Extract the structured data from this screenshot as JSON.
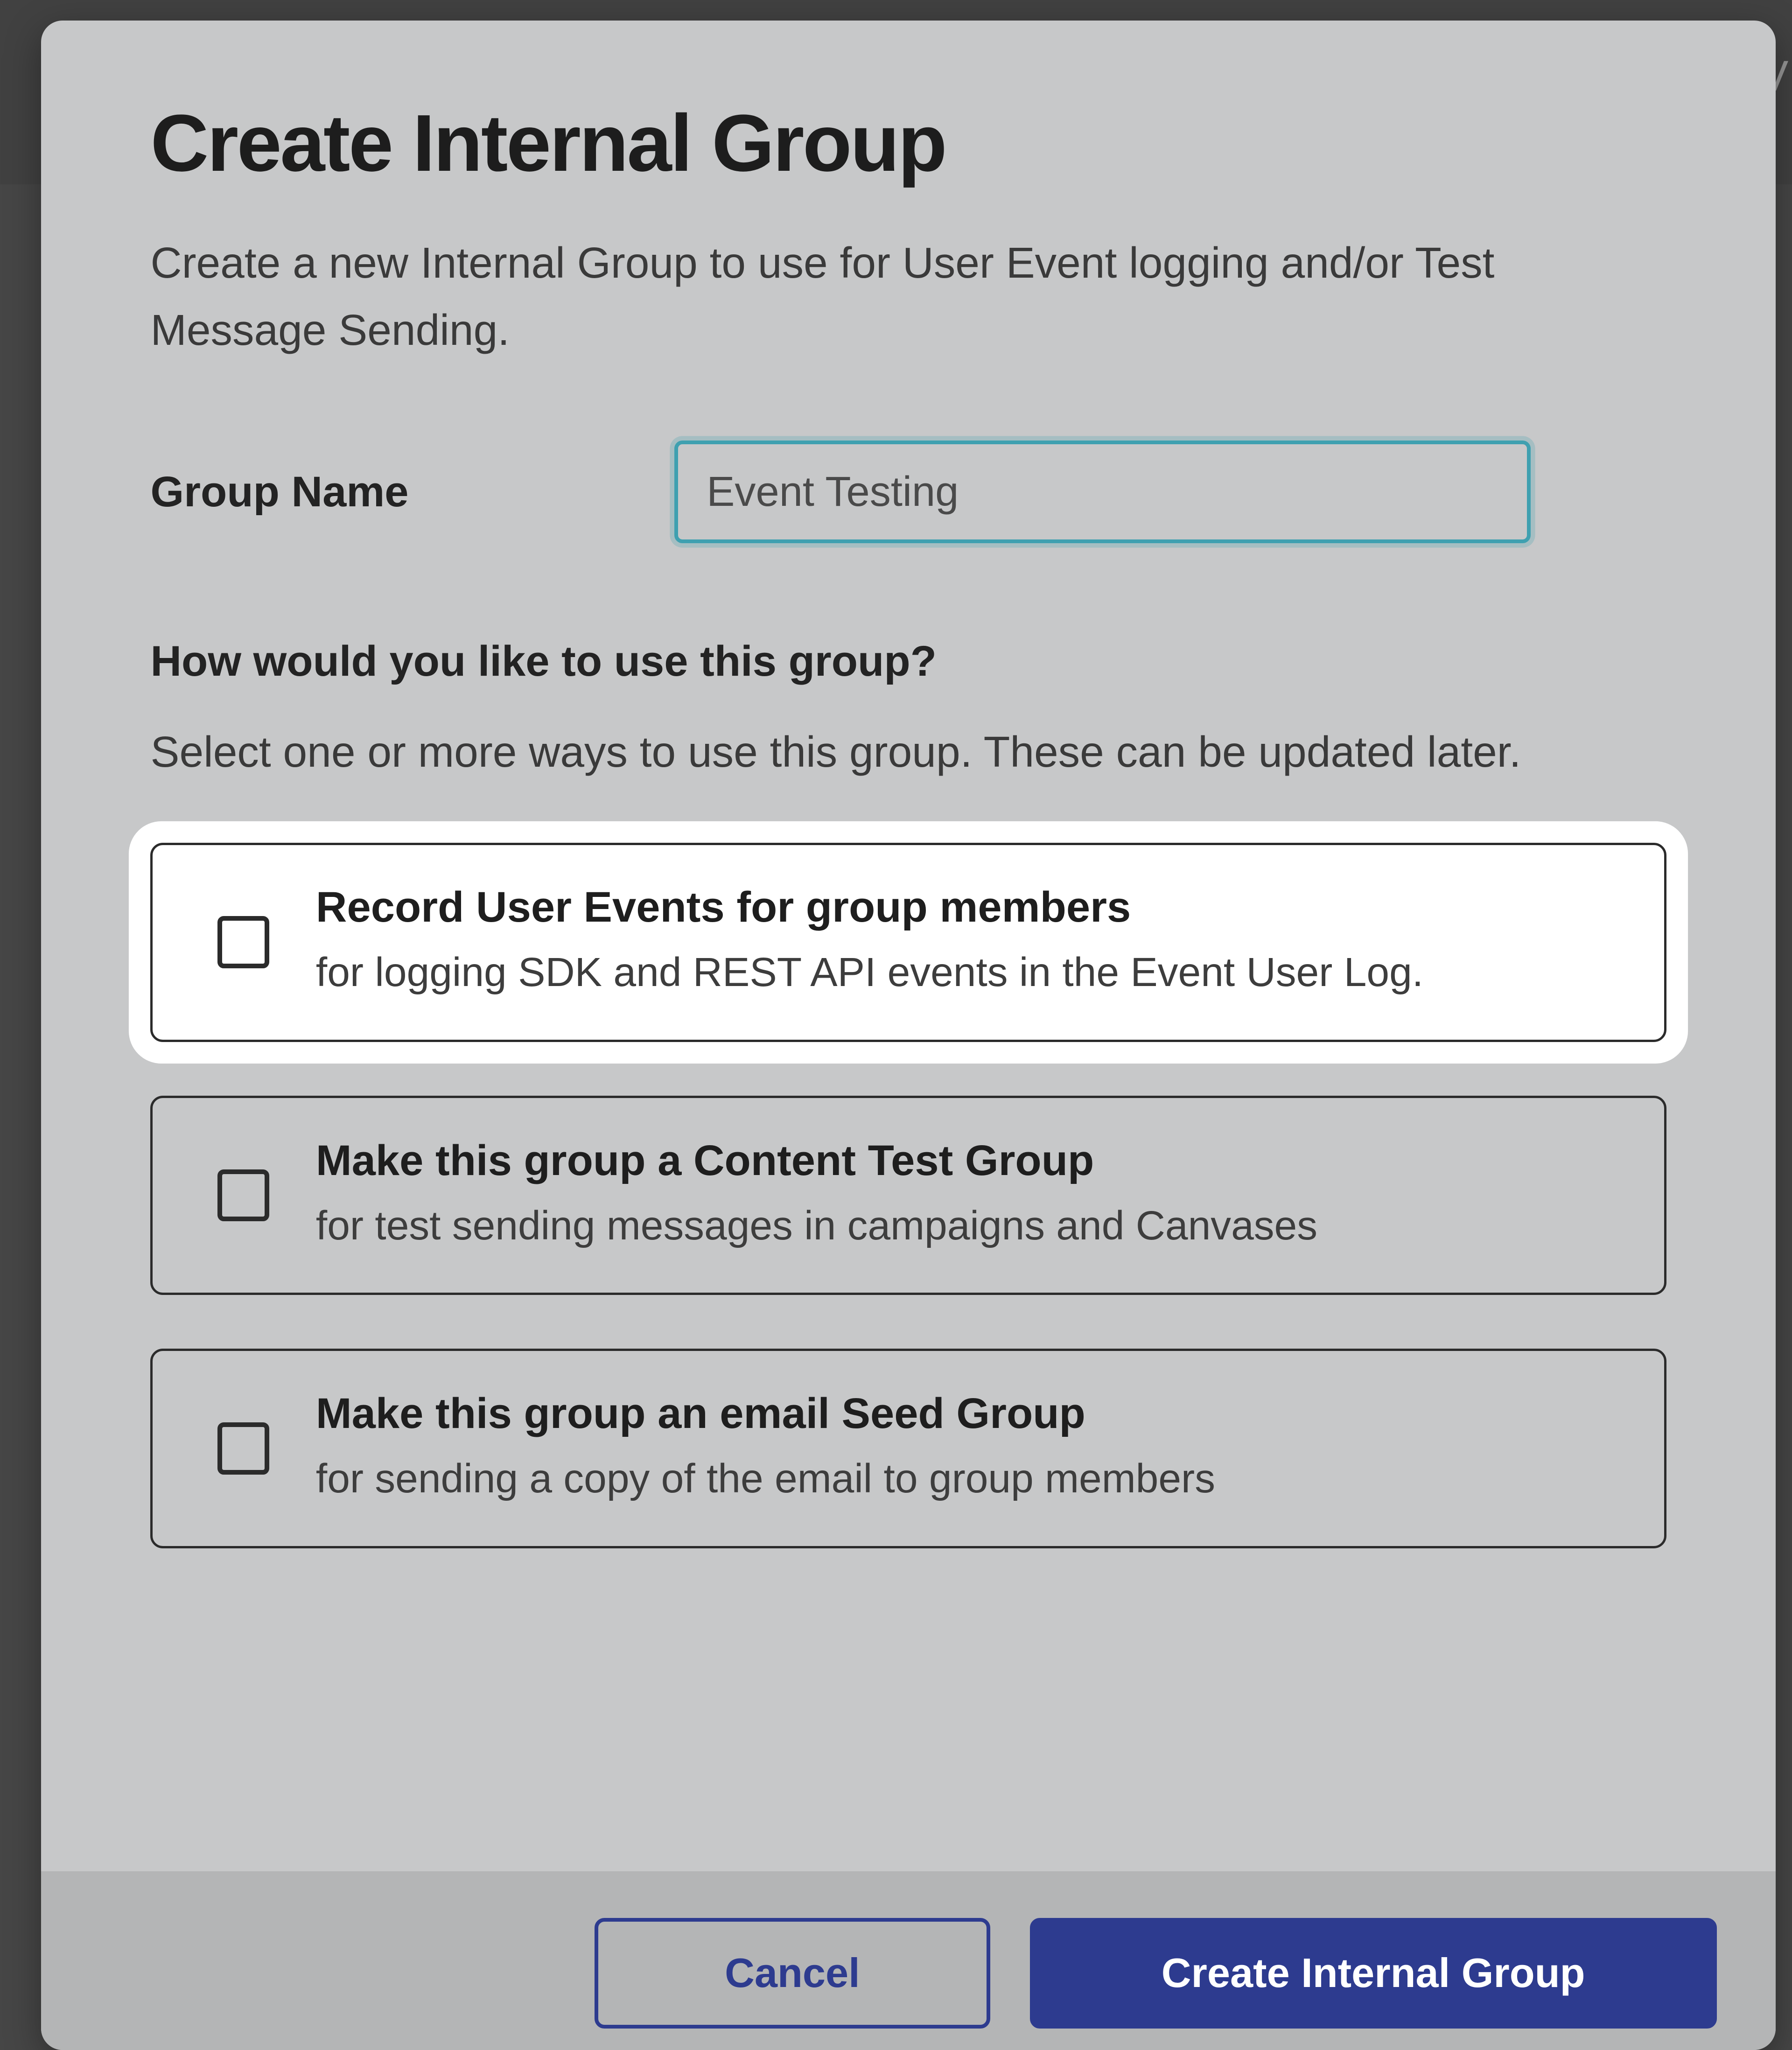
{
  "modal": {
    "title": "Create Internal Group",
    "description": "Create a new Internal Group to use for User Event logging and/or Test Message Sending.",
    "group_name_label": "Group Name",
    "group_name_value": "Event Testing",
    "usage_title": "How would you like to use this group?",
    "usage_description": "Select one or more ways to use this group. These can be updated later.",
    "options": [
      {
        "title": "Record User Events for group members",
        "subtitle": "for logging SDK and REST API events in the Event User Log."
      },
      {
        "title": "Make this group a Content Test Group",
        "subtitle": "for test sending messages in campaigns and Canvases"
      },
      {
        "title": "Make this group an email Seed Group",
        "subtitle": "for sending a copy of the email to group members"
      }
    ],
    "buttons": {
      "cancel": "Cancel",
      "submit": "Create Internal Group"
    }
  },
  "backdrop": {
    "letter": "V"
  }
}
